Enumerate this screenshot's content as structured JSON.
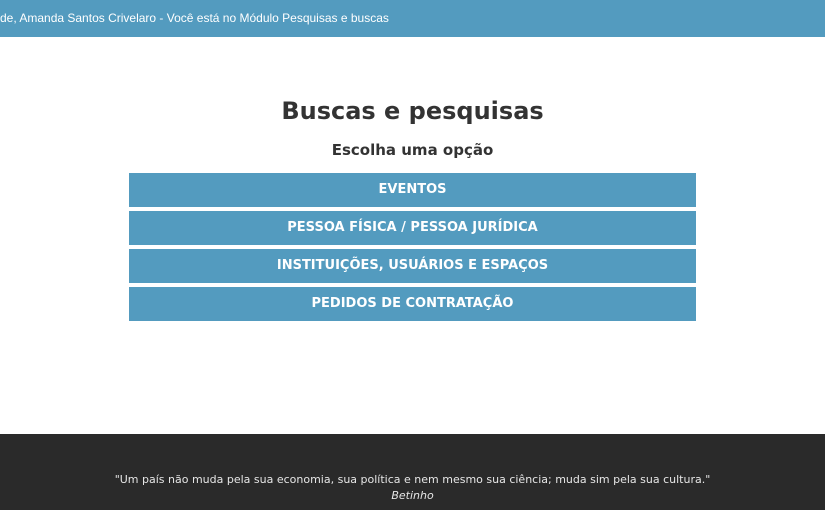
{
  "header": {
    "text": "rde, Amanda Santos Crivelaro - Você está no Módulo Pesquisas e buscas"
  },
  "main": {
    "title": "Buscas e pesquisas",
    "subtitle": "Escolha uma opção",
    "options": [
      {
        "label": "EVENTOS"
      },
      {
        "label": "PESSOA FÍSICA / PESSOA JURÍDICA"
      },
      {
        "label": "INSTITUIÇÕES, USUÁRIOS E ESPAÇOS"
      },
      {
        "label": "PEDIDOS DE CONTRATAÇÃO"
      }
    ]
  },
  "footer": {
    "quote": "\"Um país não muda pela sua economia, sua política e nem mesmo sua ciência; muda sim pela sua cultura.\"",
    "author": "Betinho"
  },
  "colors": {
    "accent": "#539bbf",
    "footer_bg": "#2a2a2a",
    "text_dark": "#333333"
  }
}
